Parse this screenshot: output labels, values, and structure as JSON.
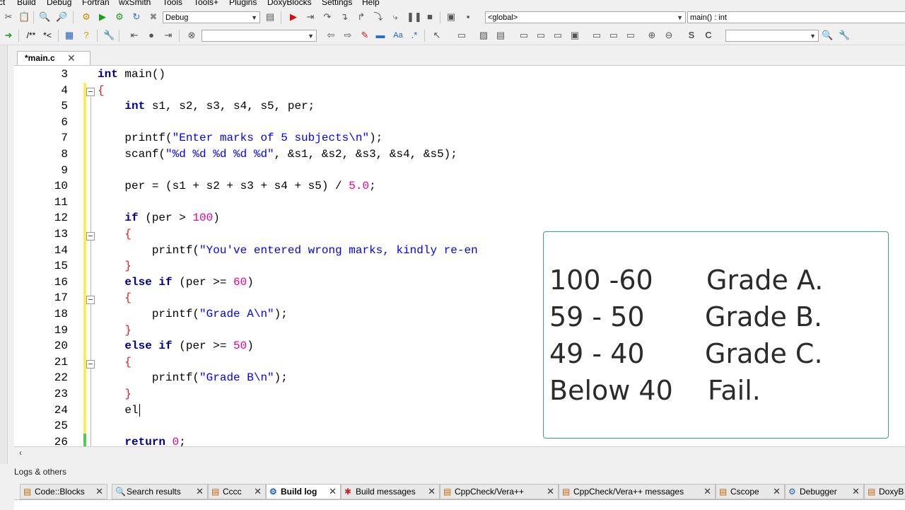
{
  "menu": [
    "ct",
    "Build",
    "Debug",
    "Fortran",
    "wxSmith",
    "Tools",
    "Tools+",
    "Plugins",
    "DoxyBlocks",
    "Settings",
    "Help"
  ],
  "toolbar": {
    "build_target": "Debug",
    "scope": "<global>",
    "function": "main() : int",
    "comment_buttons": [
      "/**",
      "*<"
    ]
  },
  "editor": {
    "tab_label": "*main.c",
    "lines": [
      {
        "n": "3",
        "parts": [
          [
            "kw",
            "int"
          ],
          [
            "",
            "main()"
          ]
        ]
      },
      {
        "n": "4",
        "parts": [
          [
            "op",
            "{"
          ]
        ]
      },
      {
        "n": "5",
        "parts": [
          [
            "",
            "    "
          ],
          [
            "kw",
            "int"
          ],
          [
            "",
            "s1, s2, s3, s4, s5, per;"
          ]
        ]
      },
      {
        "n": "6",
        "parts": []
      },
      {
        "n": "7",
        "parts": [
          [
            "",
            "    printf("
          ],
          [
            "str",
            "\"Enter marks of 5 subjects\\n\""
          ],
          [
            "",
            ");"
          ]
        ]
      },
      {
        "n": "8",
        "parts": [
          [
            "",
            "    scanf("
          ],
          [
            "str",
            "\"%d %d %d %d %d\""
          ],
          [
            "",
            ", &s1, &s2, &s3, &s4, &s5);"
          ]
        ]
      },
      {
        "n": "9",
        "parts": []
      },
      {
        "n": "10",
        "parts": [
          [
            "",
            "    per = (s1 + s2 + s3 + s4 + s5) / "
          ],
          [
            "num",
            "5.0"
          ],
          [
            "",
            ";"
          ]
        ]
      },
      {
        "n": "11",
        "parts": []
      },
      {
        "n": "12",
        "parts": [
          [
            "",
            "    "
          ],
          [
            "kw",
            "if"
          ],
          [
            "",
            "(per > "
          ],
          [
            "num",
            "100"
          ],
          [
            "",
            ")"
          ]
        ]
      },
      {
        "n": "13",
        "parts": [
          [
            "",
            "    "
          ],
          [
            "op",
            "{"
          ]
        ]
      },
      {
        "n": "14",
        "parts": [
          [
            "",
            "        printf("
          ],
          [
            "str",
            "\"You've entered wrong marks, kindly re-en"
          ]
        ]
      },
      {
        "n": "15",
        "parts": [
          [
            "",
            "    "
          ],
          [
            "op",
            "}"
          ]
        ]
      },
      {
        "n": "16",
        "parts": [
          [
            "",
            "    "
          ],
          [
            "kw",
            "else if"
          ],
          [
            "",
            "(per >= "
          ],
          [
            "num",
            "60"
          ],
          [
            "",
            ")"
          ]
        ]
      },
      {
        "n": "17",
        "parts": [
          [
            "",
            "    "
          ],
          [
            "op",
            "{"
          ]
        ]
      },
      {
        "n": "18",
        "parts": [
          [
            "",
            "        printf("
          ],
          [
            "str",
            "\"Grade A\\n\""
          ],
          [
            "",
            ");"
          ]
        ]
      },
      {
        "n": "19",
        "parts": [
          [
            "",
            "    "
          ],
          [
            "op",
            "}"
          ]
        ]
      },
      {
        "n": "20",
        "parts": [
          [
            "",
            "    "
          ],
          [
            "kw",
            "else if"
          ],
          [
            "",
            "(per >= "
          ],
          [
            "num",
            "50"
          ],
          [
            "",
            ")"
          ]
        ]
      },
      {
        "n": "21",
        "parts": [
          [
            "",
            "    "
          ],
          [
            "op",
            "{"
          ]
        ]
      },
      {
        "n": "22",
        "parts": [
          [
            "",
            "        printf("
          ],
          [
            "str",
            "\"Grade B\\n\""
          ],
          [
            "",
            ");"
          ]
        ]
      },
      {
        "n": "23",
        "parts": [
          [
            "",
            "    "
          ],
          [
            "op",
            "}"
          ]
        ]
      },
      {
        "n": "24",
        "parts": [
          [
            "",
            "    el"
          ]
        ],
        "cursor": true
      },
      {
        "n": "25",
        "parts": []
      },
      {
        "n": "26",
        "parts": [
          [
            "",
            "    "
          ],
          [
            "kw",
            "return"
          ],
          [
            "",
            ""
          ],
          [
            "num",
            "0"
          ],
          [
            "",
            ";"
          ]
        ]
      }
    ]
  },
  "grades": [
    {
      "range": "100 -60",
      "label": "Grade A."
    },
    {
      "range": "59 - 50",
      "label": "Grade B."
    },
    {
      "range": "49 - 40",
      "label": "Grade C."
    },
    {
      "range": "Below 40",
      "label": "Fail."
    }
  ],
  "logs": {
    "title": "Logs & others",
    "tabs": [
      {
        "label": "Code::Blocks",
        "active": false
      },
      {
        "label": "Search results",
        "active": false
      },
      {
        "label": "Cccc",
        "active": false
      },
      {
        "label": "Build log",
        "active": true
      },
      {
        "label": "Build messages",
        "active": false
      },
      {
        "label": "CppCheck/Vera++",
        "active": false
      },
      {
        "label": "CppCheck/Vera++ messages",
        "active": false
      },
      {
        "label": "Cscope",
        "active": false
      },
      {
        "label": "Debugger",
        "active": false
      },
      {
        "label": "DoxyB",
        "active": false
      }
    ]
  },
  "colors": {
    "keyword": "#00008b",
    "string": "#0000ff",
    "number": "#f0008a",
    "change_bar": "#f7ee5a",
    "overlay_border": "#3aa28c"
  }
}
